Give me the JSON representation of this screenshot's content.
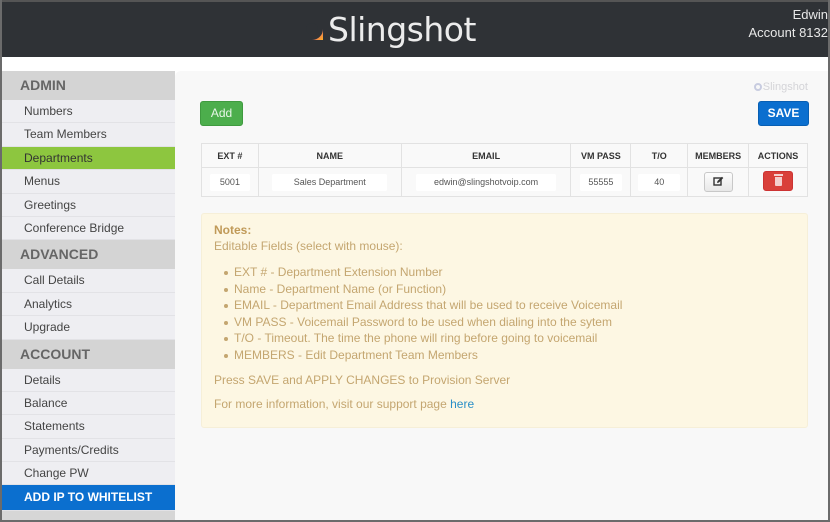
{
  "header": {
    "brand": "Slingshot",
    "user_name": "Edwin",
    "account_label": "Account 8132"
  },
  "sidebar": {
    "sections": [
      {
        "title": "ADMIN",
        "items": [
          "Numbers",
          "Team Members",
          "Departments",
          "Menus",
          "Greetings",
          "Conference Bridge"
        ]
      },
      {
        "title": "ADVANCED",
        "items": [
          "Call Details",
          "Analytics",
          "Upgrade"
        ]
      },
      {
        "title": "ACCOUNT",
        "items": [
          "Details",
          "Balance",
          "Statements",
          "Payments/Credits",
          "Change PW"
        ]
      }
    ],
    "active_item": "Departments",
    "whitelist_label": "ADD IP TO WHITELIST"
  },
  "main": {
    "watermark": "Slingshot",
    "add_label": "Add",
    "save_label": "SAVE",
    "table": {
      "columns": [
        "EXT #",
        "NAME",
        "EMAIL",
        "VM PASS",
        "T/O",
        "MEMBERS",
        "ACTIONS"
      ],
      "rows": [
        {
          "ext": "5001",
          "name": "Sales Department",
          "email": "edwin@slingshotvoip.com",
          "vm_pass": "55555",
          "timeout": "40",
          "members_icon": "edit-icon",
          "actions_icon": "trash-icon"
        }
      ]
    },
    "notes": {
      "title": "Notes:",
      "subtitle": "Editable Fields (select with mouse):",
      "items": [
        "EXT # - Department Extension Number",
        "Name - Department Name (or Function)",
        "EMAIL - Department Email Address that will be used to receive Voicemail",
        "VM PASS - Voicemail Password to be used when dialing into the sytem",
        "T/O - Timeout. The time the phone will ring before going to voicemail",
        "MEMBERS - Edit Department Team Members"
      ],
      "press_save": "Press SAVE and APPLY CHANGES to Provision Server",
      "more_info": "For more information, visit our support page ",
      "link_text": "here"
    }
  },
  "colors": {
    "topbar": "#2f3236",
    "active_green": "#8dc63f",
    "primary_blue": "#0b6fcf",
    "add_green": "#4cae4c",
    "delete_red": "#d9403a",
    "notes_bg": "#fdf7e3"
  }
}
